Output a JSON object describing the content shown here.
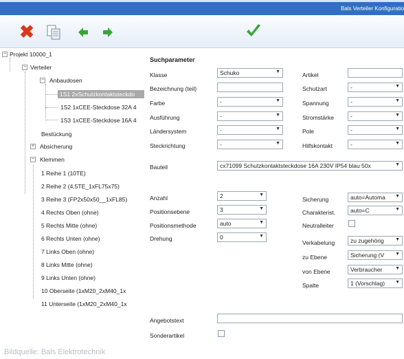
{
  "header": {
    "title": "Bals Verteiler Konfiguratio"
  },
  "toolbar": {
    "delete": "delete-icon",
    "copy": "copy-icon",
    "back": "arrow-left-icon",
    "forward": "arrow-right-icon",
    "confirm": "check-icon"
  },
  "tree": {
    "project": "Projekt 10000_1",
    "verteiler": "Verteiler",
    "anbaudosen": "Anbaudosen",
    "items": [
      "1S1 2xSchutzkontaktsteckdo",
      "1S2 1xCEE-Steckdose 32A 4",
      "1S3 1xCEE-Steckdose 16A 4"
    ],
    "bestueckung": "Bestückung",
    "absicherung": "Absicherung",
    "klemmen": "Klemmen",
    "rows": [
      "1 Reihe 1 (10TE)",
      "2 Reihe 2 (4,5TE_1xFL75x75)",
      "3 Reihe 3 (FP2x50x50__1xFL85)",
      "4 Rechts Oben (ohne)",
      "5 Rechts Mitte (ohne)",
      "6 Rechts Unten (ohne)",
      "7 Links Oben (ohne)",
      "8 Links Mitte (ohne)",
      "9 Links Unten (ohne)",
      "10 Oberseite (1xM20_2xM40_1x",
      "11 Unterseite (1xM20_2xM40_1x"
    ]
  },
  "form": {
    "heading": "Suchparameter",
    "klasse": {
      "label": "Klasse",
      "value": "Schuko"
    },
    "bezeichnung": {
      "label": "Bezeichnung (teil)",
      "value": ""
    },
    "farbe": {
      "label": "Farbe",
      "value": "-"
    },
    "ausfuehrung": {
      "label": "Ausführung",
      "value": "-"
    },
    "laendersystem": {
      "label": "Ländersystem",
      "value": "-"
    },
    "steckrichtung": {
      "label": "Steckrichtung",
      "value": "-"
    },
    "artikel": {
      "label": "Artikel",
      "value": ""
    },
    "schutzart": {
      "label": "Schutzart",
      "value": "-"
    },
    "spannung": {
      "label": "Spannung",
      "value": "-"
    },
    "stromstaerke": {
      "label": "Stromstärke",
      "value": "-"
    },
    "pole": {
      "label": "Pole",
      "value": "-"
    },
    "hilfskontakt": {
      "label": "Hilfskontakt",
      "value": "-"
    },
    "bauteil": {
      "label": "Bauteil",
      "value": "cx71099 Schutzkontaktsteckdose 16A 230V IP54 blau 50x"
    },
    "anzahl": {
      "label": "Anzahl",
      "value": "2"
    },
    "positionsebene": {
      "label": "Positionsebene",
      "value": "3"
    },
    "positionsmethode": {
      "label": "Positionsmethode",
      "value": "auto"
    },
    "drehung": {
      "label": "Drehung",
      "value": "0"
    },
    "sicherung": {
      "label": "Sicherung",
      "value": "auto=Automa"
    },
    "charakterist": {
      "label": "Charakterist.",
      "value": "auto=C"
    },
    "neutralleiter": {
      "label": "Neutralleiter"
    },
    "verkabelung": {
      "label": "Verkabelung",
      "value": "zu zugehörig"
    },
    "zu_ebene": {
      "label": "zu Ebene",
      "value": "Sicherung (V"
    },
    "von_ebene": {
      "label": "von Ebene",
      "value": "Verbraucher"
    },
    "spalte": {
      "label": "Spalte",
      "value": "1 (Vorschlag)"
    },
    "angebotstext": {
      "label": "Angebotstext",
      "value": ""
    },
    "sonderartikel": {
      "label": "Sonderartikel"
    }
  },
  "credit": "Bildquelle: Bals Elektrotechnik",
  "colors": {
    "titlebar": "#2f6fc4",
    "delete": "#d93a1a",
    "accent_green": "#3aa43a"
  }
}
